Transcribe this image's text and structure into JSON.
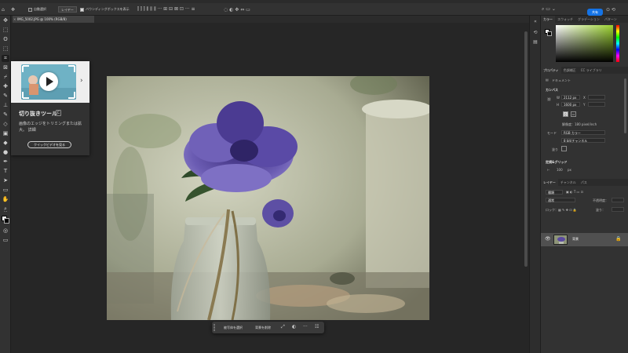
{
  "titlebar": {
    "label": "Adobe Photoshop 2024"
  },
  "options_bar": {
    "auto_select_label": "自動選択",
    "target_value": "レイヤー",
    "show_transform_label": "バウンディングボックスを表示",
    "share_label": "共有"
  },
  "document_tab": {
    "label": "IMG_5002.JPG @ 100% (RGB/8)"
  },
  "tooltip": {
    "title": "切り抜きツール",
    "shortcut": "C",
    "description": "画像のエッジをトリミングまたは拡大。 詳細",
    "button_label": "クイックビデオを見る"
  },
  "taskbar": {
    "select_subject_label": "被写体を選択",
    "remove_bg_label": "背景を削除"
  },
  "color_panel": {
    "tabs": [
      "カラー",
      "スウォッチ",
      "グラデーション",
      "パターン"
    ],
    "hue_color": "#9cd330"
  },
  "properties_panel": {
    "tabs": [
      "プロパティ",
      "色調補正",
      "CC ライブラリ"
    ],
    "doc_label": "ドキュメント",
    "canvas_label": "カンバス",
    "width_label": "W",
    "width_value": "2112 px",
    "height_label": "H",
    "height_value": "1600 px",
    "x_label": "X",
    "y_label": "Y",
    "resolution": "解像度：180 pixel/inch",
    "mode_label": "モード",
    "mode_value": "RGB カラー",
    "depth_value": "8 bit/チャンネル",
    "fill_label": "塗り",
    "guides_label": "定規&グリッド",
    "ruler_unit": "px",
    "ruler_value": "100"
  },
  "layers_panel": {
    "tabs": [
      "レイヤー",
      "チャンネル",
      "パス"
    ],
    "search_placeholder": "種類",
    "blend_mode": "通常",
    "opacity_label": "不透明度：",
    "lock_label": "ロック：",
    "fill_label": "塗り：",
    "layer_name": "背景"
  },
  "colors": {
    "accent": "#1473e6",
    "flower": "#5a4aa0"
  }
}
